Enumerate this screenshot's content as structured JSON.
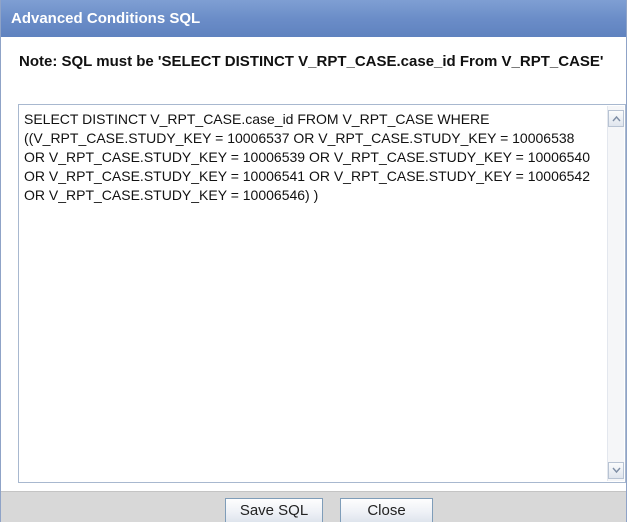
{
  "dialog": {
    "title": "Advanced Conditions SQL",
    "note": "Note: SQL must be 'SELECT DISTINCT V_RPT_CASE.case_id From V_RPT_CASE'",
    "sql_value": "SELECT DISTINCT V_RPT_CASE.case_id FROM V_RPT_CASE WHERE ((V_RPT_CASE.STUDY_KEY = 10006537 OR V_RPT_CASE.STUDY_KEY = 10006538 OR V_RPT_CASE.STUDY_KEY = 10006539 OR V_RPT_CASE.STUDY_KEY = 10006540 OR V_RPT_CASE.STUDY_KEY = 10006541 OR V_RPT_CASE.STUDY_KEY = 10006542 OR V_RPT_CASE.STUDY_KEY = 10006546)  )"
  },
  "buttons": {
    "save_label": "Save SQL",
    "close_label": "Close"
  },
  "icons": {
    "scroll_up": "chevron-up-icon",
    "scroll_down": "chevron-down-icon"
  },
  "colors": {
    "title_bar": "#6b8dc8",
    "title_text": "#ffffff",
    "footer": "#d8d8d8",
    "textarea_border": "#a8b8cf"
  }
}
